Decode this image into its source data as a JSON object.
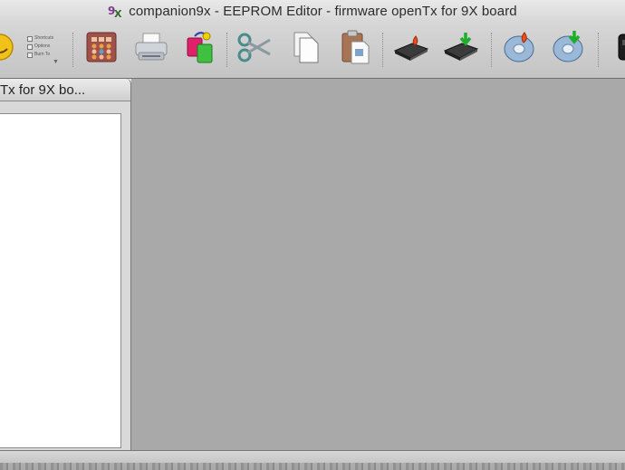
{
  "window": {
    "title": "companion9x - EEPROM Editor - firmware openTx for 9X board",
    "app_icon": "companion9x-icon"
  },
  "toolbar": {
    "mini_options": [
      "Shortcuts",
      "Options",
      "Burn To"
    ],
    "buttons": [
      {
        "id": "about",
        "icon": "smiley-icon"
      },
      {
        "id": "simulate",
        "icon": "calculator-icon"
      },
      {
        "id": "print",
        "icon": "printer-icon"
      },
      {
        "id": "compare",
        "icon": "compare-models-icon"
      },
      {
        "id": "cut",
        "icon": "scissors-icon"
      },
      {
        "id": "copy",
        "icon": "copy-icon"
      },
      {
        "id": "paste",
        "icon": "paste-icon"
      },
      {
        "id": "write-eeprom",
        "icon": "chip-write-icon"
      },
      {
        "id": "read-eeprom",
        "icon": "chip-read-icon"
      },
      {
        "id": "write-flash",
        "icon": "disk-write-icon"
      },
      {
        "id": "read-flash",
        "icon": "disk-read-icon"
      },
      {
        "id": "backup",
        "icon": "radio-icon"
      }
    ]
  },
  "subwindow": {
    "title": "Tx for 9X bo..."
  },
  "colors": {
    "mdi_background": "#a9a9a9",
    "chrome": "#d6d6d6",
    "list_background": "#ffffff"
  }
}
